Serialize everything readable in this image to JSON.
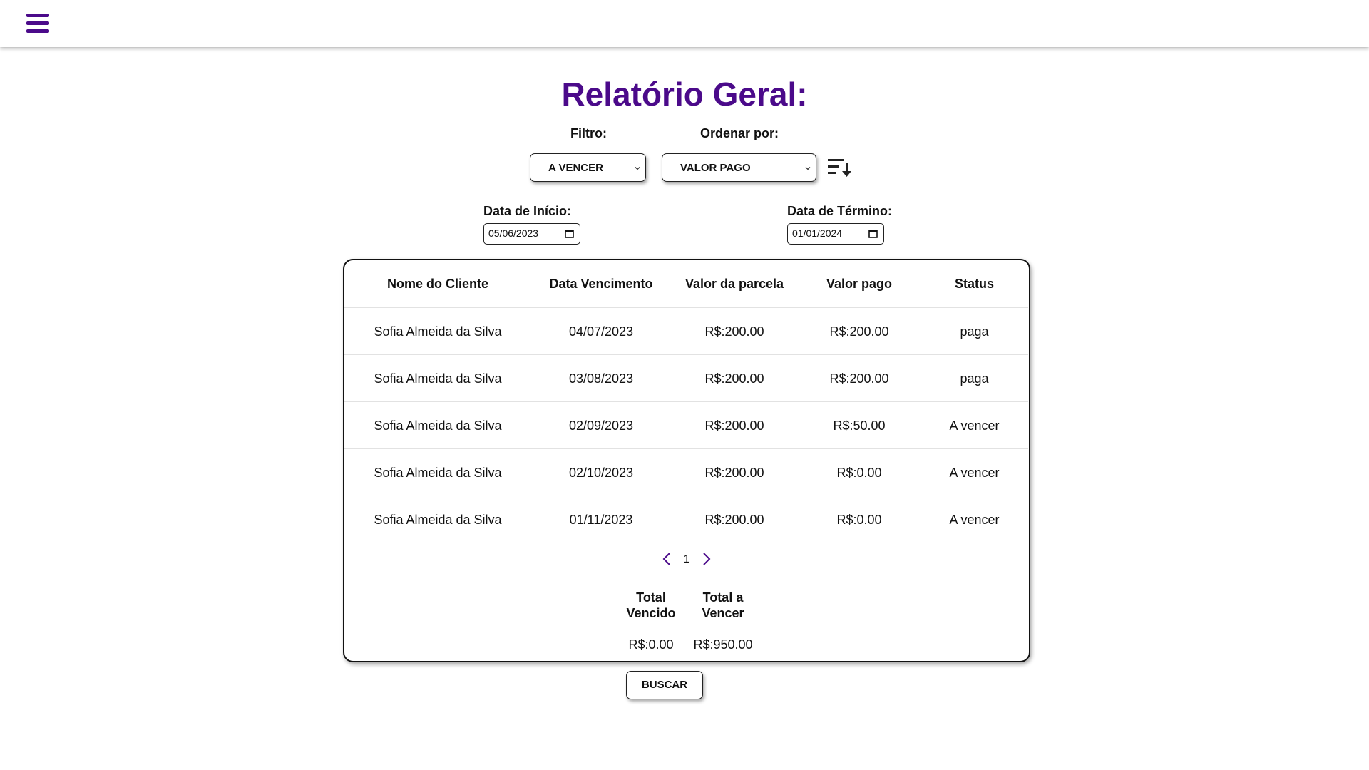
{
  "header": {
    "menu_icon": "hamburger-menu-icon"
  },
  "colors": {
    "accent": "#4b0a8a",
    "border": "#222222",
    "row_divider": "#e2e2e2"
  },
  "title": "Relatório Geral:",
  "filters": {
    "filter_label": "Filtro:",
    "filter_value": "A VENCER",
    "order_label": "Ordenar por:",
    "order_value": "VALOR PAGO",
    "sort_icon": "sort-descending-icon"
  },
  "dates": {
    "start_label": "Data de Início:",
    "start_value": "05/06/2023",
    "end_label": "Data de Término:",
    "end_value": "01/01/2024"
  },
  "table": {
    "columns": [
      "Nome do Cliente",
      "Data Vencimento",
      "Valor da parcela",
      "Valor pago",
      "Status"
    ],
    "rows": [
      [
        "Sofia Almeida da Silva",
        "04/07/2023",
        "R$:200.00",
        "R$:200.00",
        "paga"
      ],
      [
        "Sofia Almeida da Silva",
        "03/08/2023",
        "R$:200.00",
        "R$:200.00",
        "paga"
      ],
      [
        "Sofia Almeida da Silva",
        "02/09/2023",
        "R$:200.00",
        "R$:50.00",
        "A vencer"
      ],
      [
        "Sofia Almeida da Silva",
        "02/10/2023",
        "R$:200.00",
        "R$:0.00",
        "A vencer"
      ],
      [
        "Sofia Almeida da Silva",
        "01/11/2023",
        "R$:200.00",
        "R$:0.00",
        "A vencer"
      ]
    ]
  },
  "pagination": {
    "page": "1",
    "prev_icon": "chevron-left-icon",
    "next_icon": "chevron-right-icon"
  },
  "totals": {
    "vencido_label_1": "Total",
    "vencido_label_2": "Vencido",
    "vencer_label_1": "Total a",
    "vencer_label_2": "Vencer",
    "vencido_value": "R$:0.00",
    "vencer_value": "R$:950.00"
  },
  "buscar_label": "BUSCAR"
}
